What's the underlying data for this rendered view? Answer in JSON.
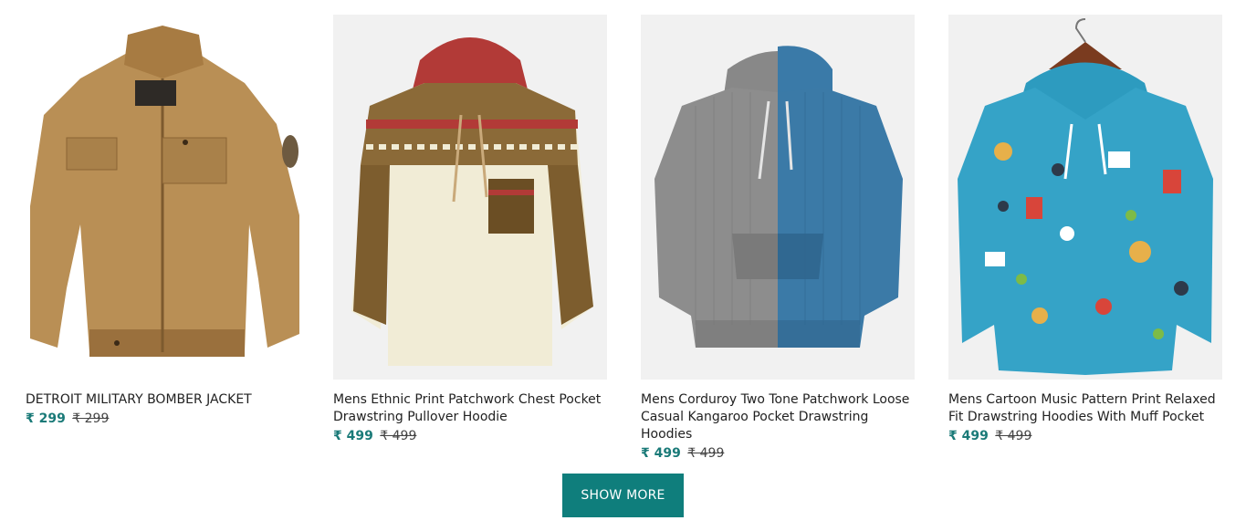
{
  "products": [
    {
      "title": "DETROIT MILITARY BOMBER JACKET",
      "price": "₹ 299",
      "mrp": "₹ 299"
    },
    {
      "title": "Mens Ethnic Print Patchwork Chest Pocket Drawstring Pullover Hoodie",
      "price": "₹ 499",
      "mrp": "₹ 499"
    },
    {
      "title": "Mens Corduroy Two Tone Patchwork Loose Casual Kangaroo Pocket Drawstring Hoodies",
      "price": "₹ 499",
      "mrp": "₹ 499"
    },
    {
      "title": "Mens Cartoon Music Pattern Print Relaxed Fit Drawstring Hoodies With Muff Pocket",
      "price": "₹ 499",
      "mrp": "₹ 499"
    }
  ],
  "show_more": {
    "label": "SHOW MORE"
  },
  "colors": {
    "accent": "#0f7e7c",
    "price": "#1a7a78"
  }
}
